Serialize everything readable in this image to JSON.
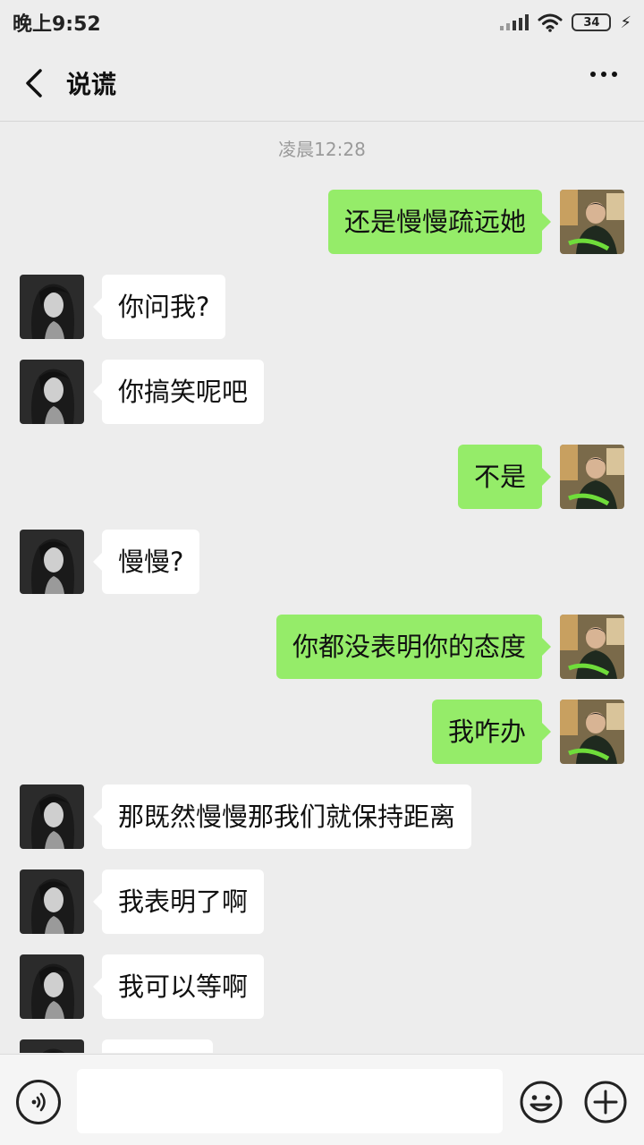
{
  "status": {
    "time": "晚上9:52",
    "battery": "34"
  },
  "header": {
    "title": "说谎"
  },
  "chat": {
    "timestamp": "凌晨12:28",
    "messages": [
      {
        "side": "out",
        "text": "还是慢慢疏远她"
      },
      {
        "side": "in",
        "text": "你问我?"
      },
      {
        "side": "in",
        "text": "你搞笑呢吧"
      },
      {
        "side": "out",
        "text": "不是"
      },
      {
        "side": "in",
        "text": "慢慢?"
      },
      {
        "side": "out",
        "text": "你都没表明你的态度"
      },
      {
        "side": "out",
        "text": "我咋办"
      },
      {
        "side": "in",
        "text": "那既然慢慢那我们就保持距离"
      },
      {
        "side": "in",
        "text": "我表明了啊"
      },
      {
        "side": "in",
        "text": "我可以等啊"
      },
      {
        "side": "in",
        "text": ""
      }
    ]
  },
  "input": {
    "value": ""
  },
  "colors": {
    "outgoing_bubble": "#95ec69",
    "incoming_bubble": "#ffffff",
    "background": "#ededed"
  }
}
